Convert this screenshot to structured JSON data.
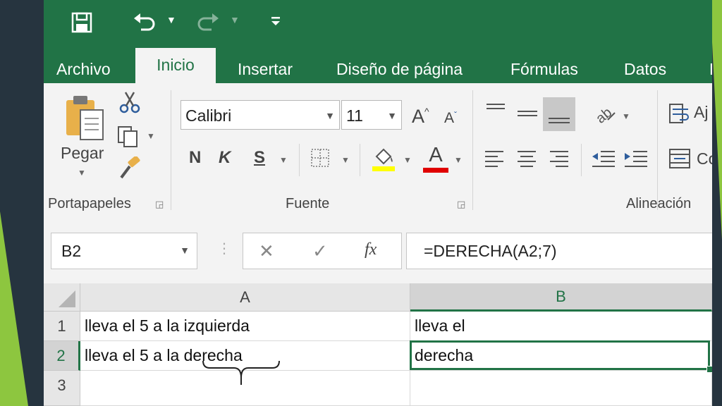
{
  "colors": {
    "excel_green": "#217346",
    "slide_green": "#8dc63f",
    "slide_dark": "#26343f"
  },
  "qat": {
    "save_icon": "save-icon",
    "undo_icon": "undo-icon",
    "redo_icon": "redo-icon",
    "customize_icon": "customize-qat-icon"
  },
  "tabs": [
    {
      "label": "Archivo"
    },
    {
      "label": "Inicio"
    },
    {
      "label": "Insertar"
    },
    {
      "label": "Diseño de página"
    },
    {
      "label": "Fórmulas"
    },
    {
      "label": "Datos"
    },
    {
      "label": "R"
    }
  ],
  "clipboard": {
    "paste_label": "Pegar",
    "group_label": "Portapapeles"
  },
  "font": {
    "name": "Calibri",
    "size": "11",
    "group_label": "Fuente",
    "bold": "N",
    "italic": "K",
    "underline": "S",
    "grow": "A",
    "shrink": "A",
    "font_color": "A"
  },
  "alignment": {
    "group_label": "Alineación",
    "wrap_label": "Aj",
    "merge_label": "Co"
  },
  "formula_bar": {
    "name_box": "B2",
    "cancel": "✕",
    "enter": "✓",
    "fx": "fx",
    "formula": "=DERECHA(A2;7)"
  },
  "grid": {
    "columns": [
      "A",
      "B"
    ],
    "rows": [
      {
        "num": "1",
        "a": "lleva el 5 a la izquierda",
        "b": "lleva el"
      },
      {
        "num": "2",
        "a_prefix": "lleva el 5 a la ",
        "a_suffix": "derecha",
        "b": "derecha"
      },
      {
        "num": "3",
        "a": "",
        "b": ""
      }
    ]
  }
}
